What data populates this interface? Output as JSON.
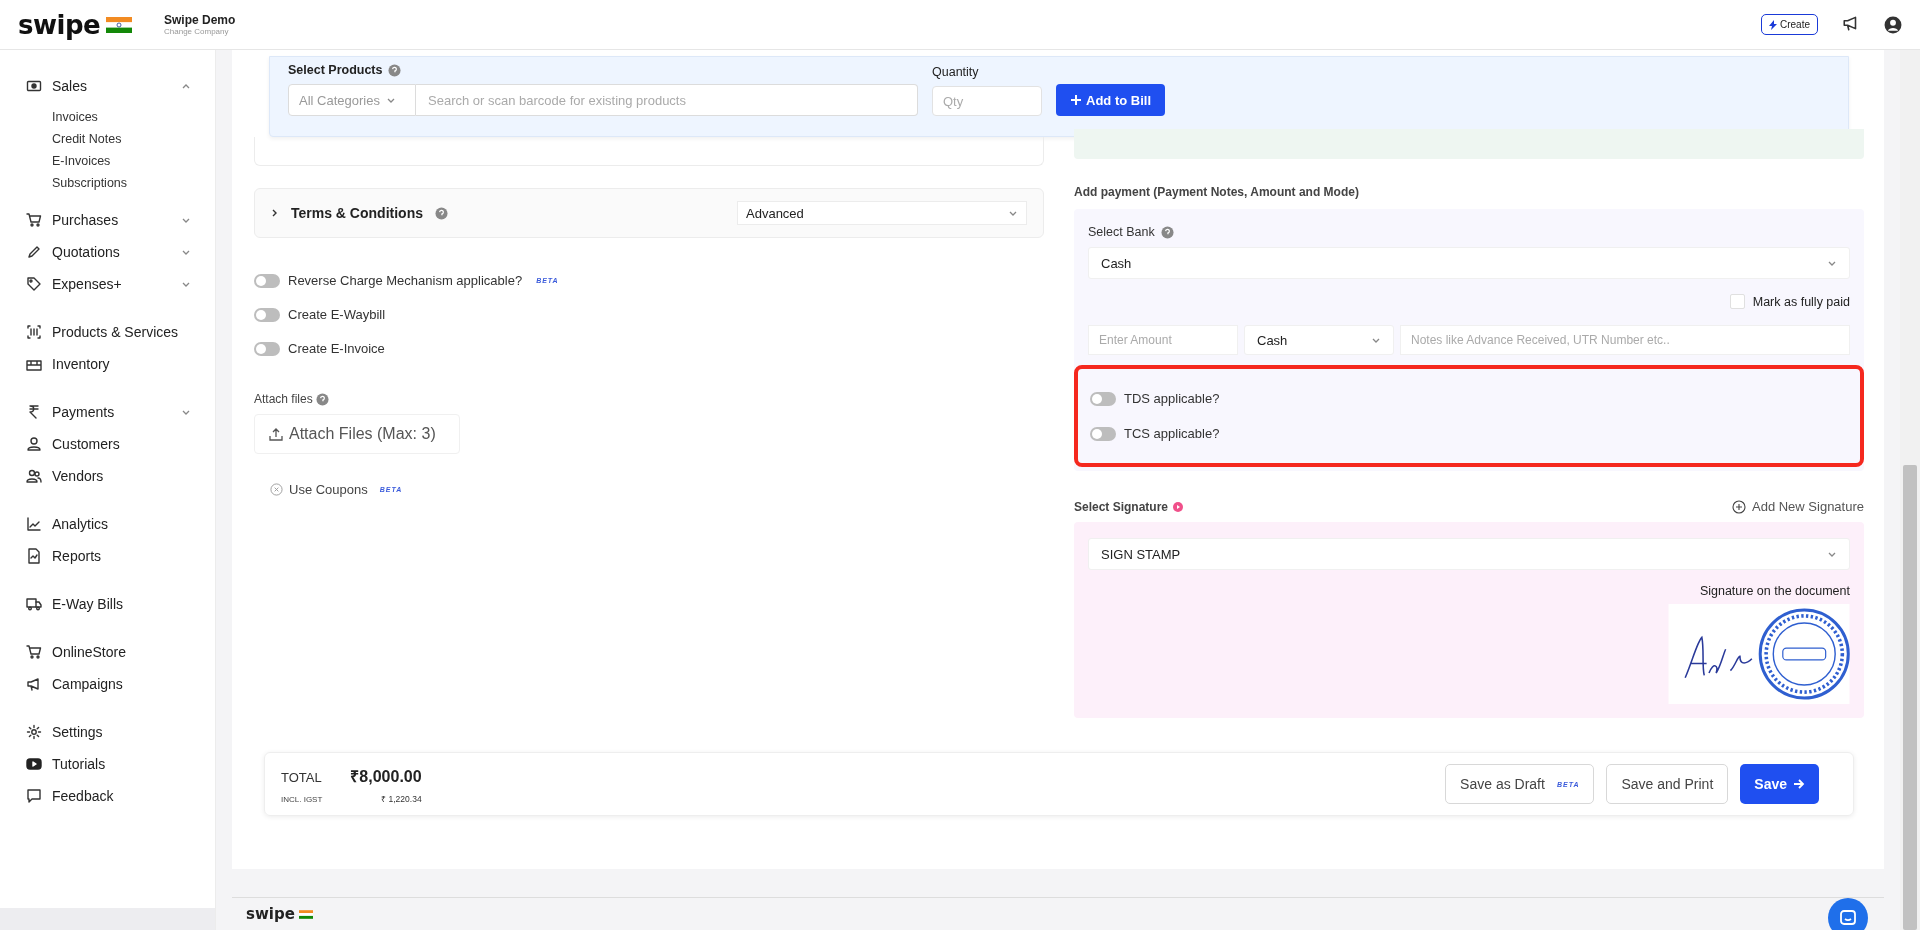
{
  "header": {
    "logo": "swipe",
    "company": "Swipe Demo",
    "company_action": "Change Company",
    "create_button": "Create"
  },
  "sidebar": {
    "groups": [
      {
        "items": [
          {
            "label": "Sales",
            "has_submenu": true,
            "expanded": true,
            "children": [
              {
                "label": "Invoices"
              },
              {
                "label": "Credit Notes"
              },
              {
                "label": "E-Invoices"
              },
              {
                "label": "Subscriptions"
              }
            ]
          },
          {
            "label": "Purchases",
            "has_submenu": true,
            "expanded": false
          },
          {
            "label": "Quotations",
            "has_submenu": true,
            "expanded": false
          },
          {
            "label": "Expenses+",
            "has_submenu": true,
            "expanded": false
          }
        ]
      },
      {
        "items": [
          {
            "label": "Products & Services",
            "has_submenu": false
          },
          {
            "label": "Inventory",
            "has_submenu": false
          }
        ]
      },
      {
        "items": [
          {
            "label": "Payments",
            "has_submenu": true,
            "expanded": false
          },
          {
            "label": "Customers",
            "has_submenu": false
          },
          {
            "label": "Vendors",
            "has_submenu": false
          }
        ]
      },
      {
        "items": [
          {
            "label": "Analytics",
            "has_submenu": false
          },
          {
            "label": "Reports",
            "has_submenu": false
          }
        ]
      },
      {
        "items": [
          {
            "label": "E-Way Bills",
            "has_submenu": false
          }
        ]
      },
      {
        "items": [
          {
            "label": "OnlineStore",
            "has_submenu": false
          },
          {
            "label": "Campaigns",
            "has_submenu": false
          }
        ]
      },
      {
        "items": [
          {
            "label": "Settings",
            "has_submenu": false
          },
          {
            "label": "Tutorials",
            "has_submenu": false
          },
          {
            "label": "Feedback",
            "has_submenu": false
          }
        ]
      }
    ]
  },
  "product_bar": {
    "label": "Select Products",
    "category": "All Categories",
    "search_placeholder": "Search or scan barcode for existing products",
    "quantity_label": "Quantity",
    "quantity_placeholder": "Qty",
    "add_button": "Add to Bill"
  },
  "terms": {
    "label": "Terms & Conditions",
    "select": "Advanced",
    "expanded": false
  },
  "toggles": [
    {
      "label": "Reverse Charge Mechanism applicable?",
      "on": false,
      "badge": "BETA"
    },
    {
      "label": "Create E-Waybill",
      "on": false
    },
    {
      "label": "Create E-Invoice",
      "on": false
    }
  ],
  "attach": {
    "label": "Attach files",
    "button": "Attach Files (Max: 3)"
  },
  "coupons": {
    "label": "Use Coupons",
    "badge": "BETA"
  },
  "payment": {
    "heading": "Add payment (Payment Notes, Amount and Mode)",
    "bank_label": "Select Bank",
    "bank": "Cash",
    "fully_paid": {
      "label": "Mark as fully paid",
      "checked": false
    },
    "amount_placeholder": "Enter Amount",
    "mode": "Cash",
    "notes_placeholder": "Notes like Advance Received, UTR Number etc.."
  },
  "tax_toggles": [
    {
      "label": "TDS applicable?",
      "on": false
    },
    {
      "label": "TCS applicable?",
      "on": false
    }
  ],
  "signature": {
    "label": "Select Signature",
    "add_button": "Add New Signature",
    "select": "SIGN STAMP",
    "caption": "Signature on the document"
  },
  "totals": {
    "label": "TOTAL",
    "amount": "₹8,000.00",
    "tax_label": "INCL. IGST",
    "tax": "₹ 1,220.34"
  },
  "actions": [
    {
      "label": "Save as Draft",
      "badge": "BETA",
      "kind": "outline"
    },
    {
      "label": "Save and Print",
      "kind": "outline"
    },
    {
      "label": "Save",
      "kind": "primary"
    }
  ],
  "footer": {
    "logo": "swipe"
  }
}
